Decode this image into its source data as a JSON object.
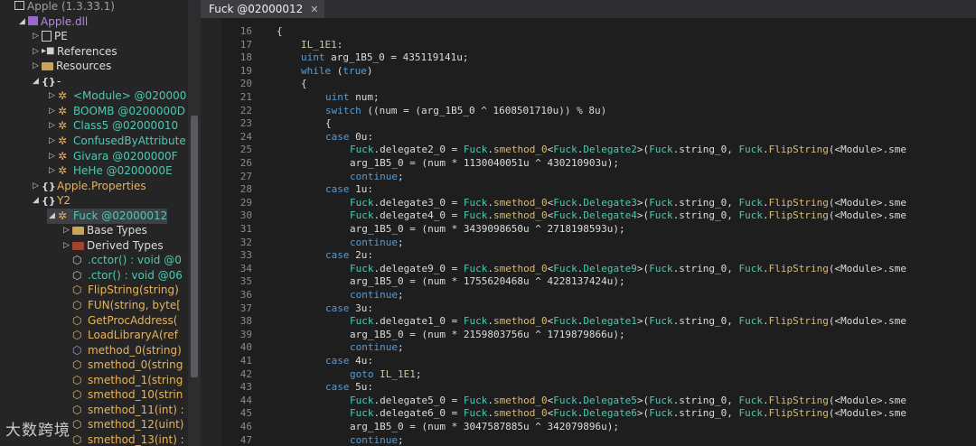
{
  "tree": {
    "items": [
      {
        "indent": 0,
        "arrow": "",
        "icon": "window-icon",
        "label": "Apple (1.3.33.1)",
        "color": "t-gray"
      },
      {
        "indent": 1,
        "arrow": "◢",
        "icon": "assembly-icon",
        "label": "Apple.dll",
        "color": "t-purple"
      },
      {
        "indent": 2,
        "arrow": "▷",
        "icon": "pe-icon",
        "label": "PE",
        "color": "t-white"
      },
      {
        "indent": 2,
        "arrow": "▷",
        "icon": "references-icon",
        "label": "References",
        "color": "t-white"
      },
      {
        "indent": 2,
        "arrow": "▷",
        "icon": "folder-icon",
        "label": "Resources",
        "color": "t-white"
      },
      {
        "indent": 2,
        "arrow": "◢",
        "icon": "namespace-icon",
        "label": "-",
        "color": "t-white"
      },
      {
        "indent": 3,
        "arrow": "▷",
        "icon": "class-icon",
        "label": "<Module> @020000",
        "color": "t-cls"
      },
      {
        "indent": 3,
        "arrow": "▷",
        "icon": "class-icon",
        "label": "BOOMB @0200000D",
        "color": "t-cls"
      },
      {
        "indent": 3,
        "arrow": "▷",
        "icon": "class-icon",
        "label": "Class5 @02000010",
        "color": "t-cls"
      },
      {
        "indent": 3,
        "arrow": "▷",
        "icon": "class-icon",
        "label": "ConfusedByAttribute",
        "color": "t-cls"
      },
      {
        "indent": 3,
        "arrow": "▷",
        "icon": "class-icon",
        "label": "Givara @0200000F",
        "color": "t-cls"
      },
      {
        "indent": 3,
        "arrow": "▷",
        "icon": "class-icon",
        "label": "HeHe @0200000E",
        "color": "t-cls"
      },
      {
        "indent": 2,
        "arrow": "▷",
        "icon": "namespace-icon",
        "label": "Apple.Properties",
        "color": "t-yellow"
      },
      {
        "indent": 2,
        "arrow": "◢",
        "icon": "namespace-icon",
        "label": "Y2",
        "color": "t-yellow"
      },
      {
        "indent": 3,
        "arrow": "◢",
        "icon": "class-icon",
        "label": "Fuck @02000012",
        "color": "t-cls",
        "selected": true
      },
      {
        "indent": 4,
        "arrow": "▷",
        "icon": "folder-icon",
        "label": "Base Types",
        "color": "t-white"
      },
      {
        "indent": 4,
        "arrow": "▷",
        "icon": "folder-red-icon",
        "label": "Derived Types",
        "color": "t-white"
      },
      {
        "indent": 4,
        "arrow": "",
        "icon": "method-icon",
        "label": ".cctor() : void @0",
        "color": "t-cls"
      },
      {
        "indent": 4,
        "arrow": "",
        "icon": "method-icon",
        "label": ".ctor() : void @06",
        "color": "t-cls"
      },
      {
        "indent": 4,
        "arrow": "",
        "icon": "method-static-icon",
        "label": "FlipString(string)",
        "color": "t-orange"
      },
      {
        "indent": 4,
        "arrow": "",
        "icon": "method-static-icon",
        "label": "FUN(string, byte[",
        "color": "t-orange"
      },
      {
        "indent": 4,
        "arrow": "",
        "icon": "method-static-icon",
        "label": "GetProcAddress(",
        "color": "t-orange"
      },
      {
        "indent": 4,
        "arrow": "",
        "icon": "method-static-icon",
        "label": "LoadLibraryA(ref",
        "color": "t-orange"
      },
      {
        "indent": 4,
        "arrow": "",
        "icon": "method-private-icon",
        "label": "method_0(string)",
        "color": "t-orange"
      },
      {
        "indent": 4,
        "arrow": "",
        "icon": "method-static-icon",
        "label": "smethod_0(string",
        "color": "t-orange"
      },
      {
        "indent": 4,
        "arrow": "",
        "icon": "method-static-icon",
        "label": "smethod_1(string",
        "color": "t-orange"
      },
      {
        "indent": 4,
        "arrow": "",
        "icon": "method-static-icon",
        "label": "smethod_10(strin",
        "color": "t-orange"
      },
      {
        "indent": 4,
        "arrow": "",
        "icon": "method-static-icon",
        "label": "smethod_11(int) :",
        "color": "t-orange"
      },
      {
        "indent": 4,
        "arrow": "",
        "icon": "method-static-icon",
        "label": "smethod_12(uint)",
        "color": "t-orange"
      },
      {
        "indent": 4,
        "arrow": "",
        "icon": "method-static-icon",
        "label": "smethod_13(int) :",
        "color": "t-orange"
      }
    ]
  },
  "tab": {
    "label": "Fuck @02000012",
    "close": "✕"
  },
  "code": {
    "lines": [
      {
        "n": "16",
        "i": 0,
        "t": "{"
      },
      {
        "n": "17",
        "i": 1,
        "t": "IL_1E1:"
      },
      {
        "n": "18",
        "i": 1,
        "t": "uint arg_1B5_0 = 435119141u;"
      },
      {
        "n": "19",
        "i": 1,
        "t": "while (true)"
      },
      {
        "n": "20",
        "i": 1,
        "t": "{"
      },
      {
        "n": "21",
        "i": 2,
        "t": "uint num;"
      },
      {
        "n": "22",
        "i": 2,
        "t": "switch ((num = (arg_1B5_0 ^ 1608501710u)) % 8u)"
      },
      {
        "n": "23",
        "i": 2,
        "t": "{"
      },
      {
        "n": "24",
        "i": 2,
        "t": "case 0u:"
      },
      {
        "n": "25",
        "i": 3,
        "t": "Fuck.delegate2_0 = Fuck.smethod_0<Fuck.Delegate2>(Fuck.string_0, Fuck.FlipString(<Module>.sme"
      },
      {
        "n": "26",
        "i": 3,
        "t": "arg_1B5_0 = (num * 1130040051u ^ 430210903u);"
      },
      {
        "n": "27",
        "i": 3,
        "t": "continue;"
      },
      {
        "n": "28",
        "i": 2,
        "t": "case 1u:"
      },
      {
        "n": "29",
        "i": 3,
        "t": "Fuck.delegate3_0 = Fuck.smethod_0<Fuck.Delegate3>(Fuck.string_0, Fuck.FlipString(<Module>.sme"
      },
      {
        "n": "30",
        "i": 3,
        "t": "Fuck.delegate4_0 = Fuck.smethod_0<Fuck.Delegate4>(Fuck.string_0, Fuck.FlipString(<Module>.sme"
      },
      {
        "n": "31",
        "i": 3,
        "t": "arg_1B5_0 = (num * 3439098650u ^ 2718198593u);"
      },
      {
        "n": "32",
        "i": 3,
        "t": "continue;"
      },
      {
        "n": "33",
        "i": 2,
        "t": "case 2u:"
      },
      {
        "n": "34",
        "i": 3,
        "t": "Fuck.delegate9_0 = Fuck.smethod_0<Fuck.Delegate9>(Fuck.string_0, Fuck.FlipString(<Module>.sme"
      },
      {
        "n": "35",
        "i": 3,
        "t": "arg_1B5_0 = (num * 1755620468u ^ 4228137424u);"
      },
      {
        "n": "36",
        "i": 3,
        "t": "continue;"
      },
      {
        "n": "37",
        "i": 2,
        "t": "case 3u:"
      },
      {
        "n": "38",
        "i": 3,
        "t": "Fuck.delegate1_0 = Fuck.smethod_0<Fuck.Delegate1>(Fuck.string_0, Fuck.FlipString(<Module>.sme"
      },
      {
        "n": "39",
        "i": 3,
        "t": "arg_1B5_0 = (num * 2159803756u ^ 1719879866u);"
      },
      {
        "n": "40",
        "i": 3,
        "t": "continue;"
      },
      {
        "n": "41",
        "i": 2,
        "t": "case 4u:"
      },
      {
        "n": "42",
        "i": 3,
        "t": "goto IL_1E1;"
      },
      {
        "n": "43",
        "i": 2,
        "t": "case 5u:"
      },
      {
        "n": "44",
        "i": 3,
        "t": "Fuck.delegate5_0 = Fuck.smethod_0<Fuck.Delegate5>(Fuck.string_0, Fuck.FlipString(<Module>.sme"
      },
      {
        "n": "45",
        "i": 3,
        "t": "Fuck.delegate6_0 = Fuck.smethod_0<Fuck.Delegate6>(Fuck.string_0, Fuck.FlipString(<Module>.sme"
      },
      {
        "n": "46",
        "i": 3,
        "t": "arg_1B5_0 = (num * 3047587885u ^ 342079896u);"
      },
      {
        "n": "47",
        "i": 3,
        "t": "continue;"
      }
    ]
  },
  "watermark": "大数跨境"
}
